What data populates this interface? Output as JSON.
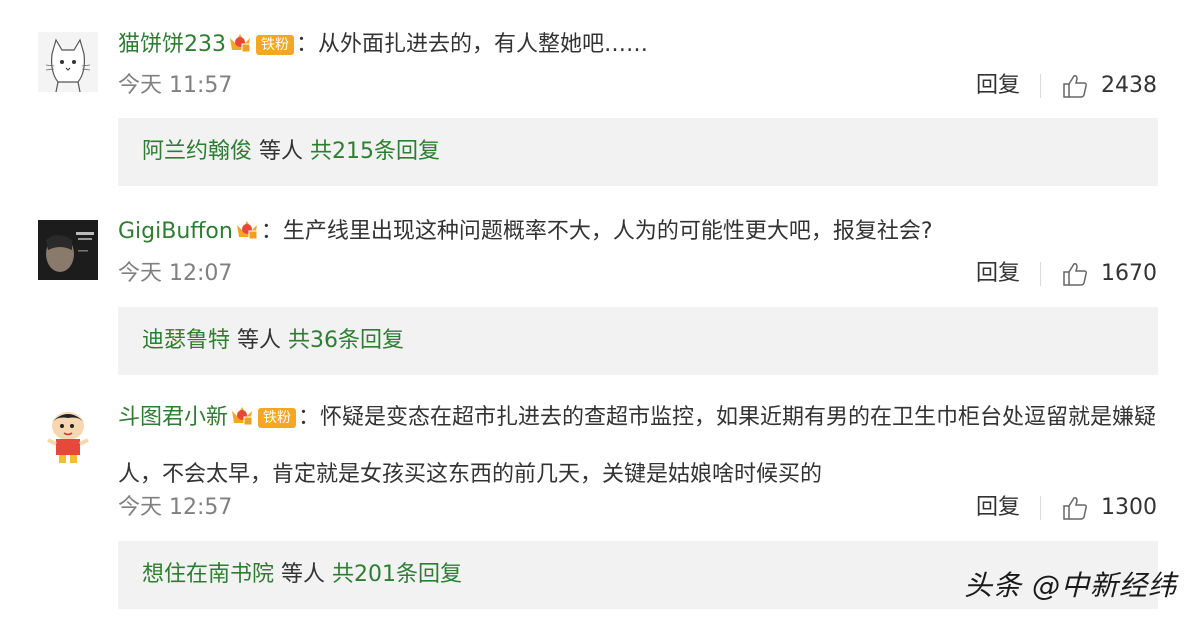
{
  "comments": [
    {
      "username": "猫饼饼233",
      "badge_text": "铁粉",
      "colon": "：",
      "text": "从外面扎进去的，有人整她吧……",
      "time": "今天 11:57",
      "reply_label": "回复",
      "likes": "2438",
      "replies_user": "阿兰约翰俊",
      "replies_mid": " 等人 ",
      "replies_total": "共215条回复"
    },
    {
      "username": "GigiBuffon",
      "colon": "：",
      "text": "生产线里出现这种问题概率不大，人为的可能性更大吧，报复社会?",
      "time": "今天 12:07",
      "reply_label": "回复",
      "likes": "1670",
      "replies_user": "迪瑟鲁特",
      "replies_mid": " 等人 ",
      "replies_total": "共36条回复"
    },
    {
      "username": "斗图君小新",
      "badge_text": "铁粉",
      "colon": "：",
      "text": "怀疑是变态在超市扎进去的查超市监控，如果近期有男的在卫生巾柜台处逗留就是嫌疑人，不会太早，肯定就是女孩买这东西的前几天，关键是姑娘啥时候买的",
      "time": "今天 12:57",
      "reply_label": "回复",
      "likes": "1300",
      "replies_user": "想住在南书院",
      "replies_mid": " 等人 ",
      "replies_total": "共201条回复"
    }
  ],
  "watermark": "头条 @中新经纬",
  "colors": {
    "username": "#2e7d32",
    "badge": "#f5a623",
    "reply_bg": "#f2f2f2"
  }
}
